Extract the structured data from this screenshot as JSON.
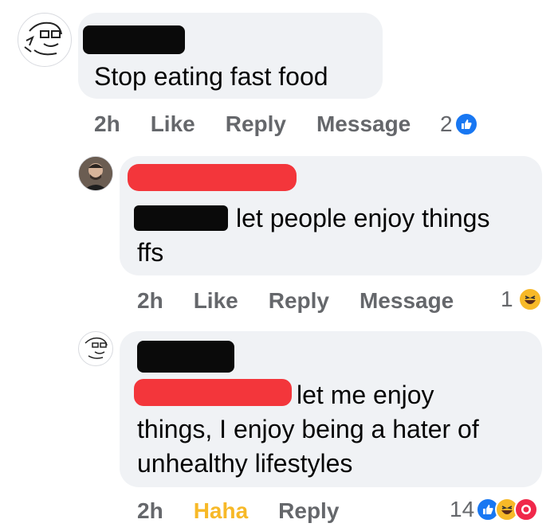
{
  "comments": [
    {
      "text": "Stop eating fast food",
      "actions": {
        "time": "2h",
        "like": "Like",
        "reply": "Reply",
        "message": "Message"
      },
      "reaction_count": "2",
      "reactions": [
        "like-icon"
      ]
    },
    {
      "text_line1": "let people enjoy things",
      "text_line2": "ffs",
      "actions": {
        "time": "2h",
        "like": "Like",
        "reply": "Reply",
        "message": "Message"
      },
      "reaction_count": "1",
      "reactions": [
        "haha-icon"
      ]
    },
    {
      "text_line1": "let me enjoy",
      "text_line2": "things, I enjoy being a hater of",
      "text_line3": "unhealthy lifestyles",
      "actions": {
        "time": "2h",
        "reacted": "Haha",
        "reply": "Reply"
      },
      "reaction_count": "14",
      "reactions": [
        "like-icon",
        "haha-icon",
        "wow-icon"
      ]
    }
  ],
  "colors": {
    "bubble": "#f0f2f5",
    "meta_text": "#65676b",
    "like_blue": "#1877f2",
    "haha_yellow": "#f7b928",
    "wow_red": "#f0284a",
    "redaction_red": "#f3363b",
    "redaction_black": "#0a0a0a"
  }
}
